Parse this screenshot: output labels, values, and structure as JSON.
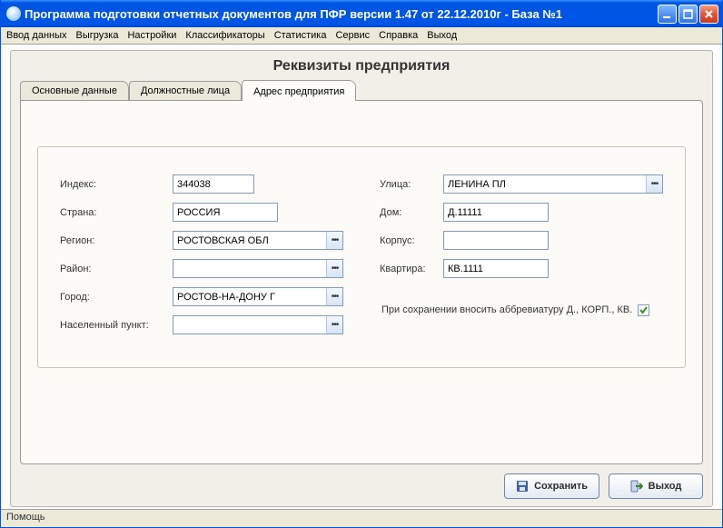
{
  "titlebar": {
    "title": "Программа подготовки отчетных документов для ПФР версии 1.47 от 22.12.2010г - База №1"
  },
  "menu": {
    "items": [
      "Ввод данных",
      "Выгрузка",
      "Настройки",
      "Классификаторы",
      "Статистика",
      "Сервис",
      "Справка",
      "Выход"
    ]
  },
  "page_title": "Реквизиты предприятия",
  "tabs": {
    "items": [
      {
        "label": "Основные данные"
      },
      {
        "label": "Должностные лица"
      },
      {
        "label": "Адрес предприятия"
      }
    ],
    "active": 2
  },
  "form": {
    "left": {
      "index": {
        "label": "Индекс:",
        "value": "344038"
      },
      "country": {
        "label": "Страна:",
        "value": "РОССИЯ"
      },
      "region": {
        "label": "Регион:",
        "value": "РОСТОВСКАЯ ОБЛ"
      },
      "raion": {
        "label": "Район:",
        "value": ""
      },
      "city": {
        "label": "Город:",
        "value": "РОСТОВ-НА-ДОНУ Г"
      },
      "nasp": {
        "label": "Населенный пункт:",
        "value": ""
      }
    },
    "right": {
      "street": {
        "label": "Улица:",
        "value": "ЛЕНИНА ПЛ"
      },
      "house": {
        "label": "Дом:",
        "value": "Д.11111"
      },
      "korp": {
        "label": "Корпус:",
        "value": ""
      },
      "flat": {
        "label": "Квартира:",
        "value": "КВ.1111"
      }
    },
    "checkbox": {
      "label": "При сохранении вносить аббревиатуру Д., КОРП., КВ.",
      "checked": true
    }
  },
  "buttons": {
    "save": "Сохранить",
    "exit": "Выход"
  },
  "statusbar": {
    "help": "Помощь"
  }
}
